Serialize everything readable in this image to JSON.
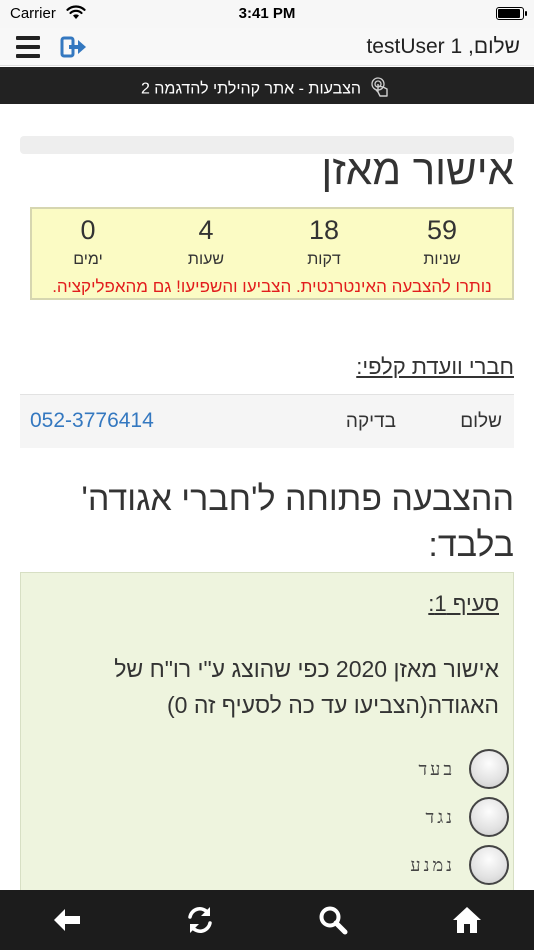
{
  "status_bar": {
    "carrier": "Carrier",
    "time": "3:41 PM",
    "battery_level": 1.0
  },
  "header": {
    "greeting": "שלום, testUser 1",
    "menu_icon": "hamburger-menu-icon",
    "logout_icon": "logout-icon"
  },
  "site_bar": {
    "title": "הצבעות - אתר קהילתי להדגמה 2",
    "icon": "touch-icon"
  },
  "page": {
    "title": "אישור מאזן"
  },
  "countdown": {
    "units": [
      {
        "value": "59",
        "label": "שניות"
      },
      {
        "value": "18",
        "label": "דקות"
      },
      {
        "value": "4",
        "label": "שעות"
      },
      {
        "value": "0",
        "label": "ימים"
      }
    ],
    "message": "נותרו להצבעה האינטרנטית. הצביעו והשפיעו! גם מהאפליקציה.",
    "colors": {
      "background": "#fbfbc4",
      "message": "#e21d1d"
    }
  },
  "committee": {
    "title": "חברי וועדת קלפי:",
    "members": [
      {
        "first": "שלום",
        "last": "בדיקה",
        "phone": "052-3776414"
      }
    ]
  },
  "vote": {
    "heading": "ההצבעה פתוחה ל'חברי אגודה' בלבד:",
    "sections": [
      {
        "title": "סעיף 1:",
        "description": "אישור מאזן 2020 כפי שהוצג ע\"י רו\"ח של האגודה(הצביעו עד כה לסעיף זה 0)",
        "options": [
          "בעד",
          "נגד",
          "נמנע"
        ]
      }
    ]
  },
  "bottom_bar": {
    "buttons": [
      "back-arrow-icon",
      "refresh-icon",
      "search-icon",
      "home-icon"
    ]
  }
}
